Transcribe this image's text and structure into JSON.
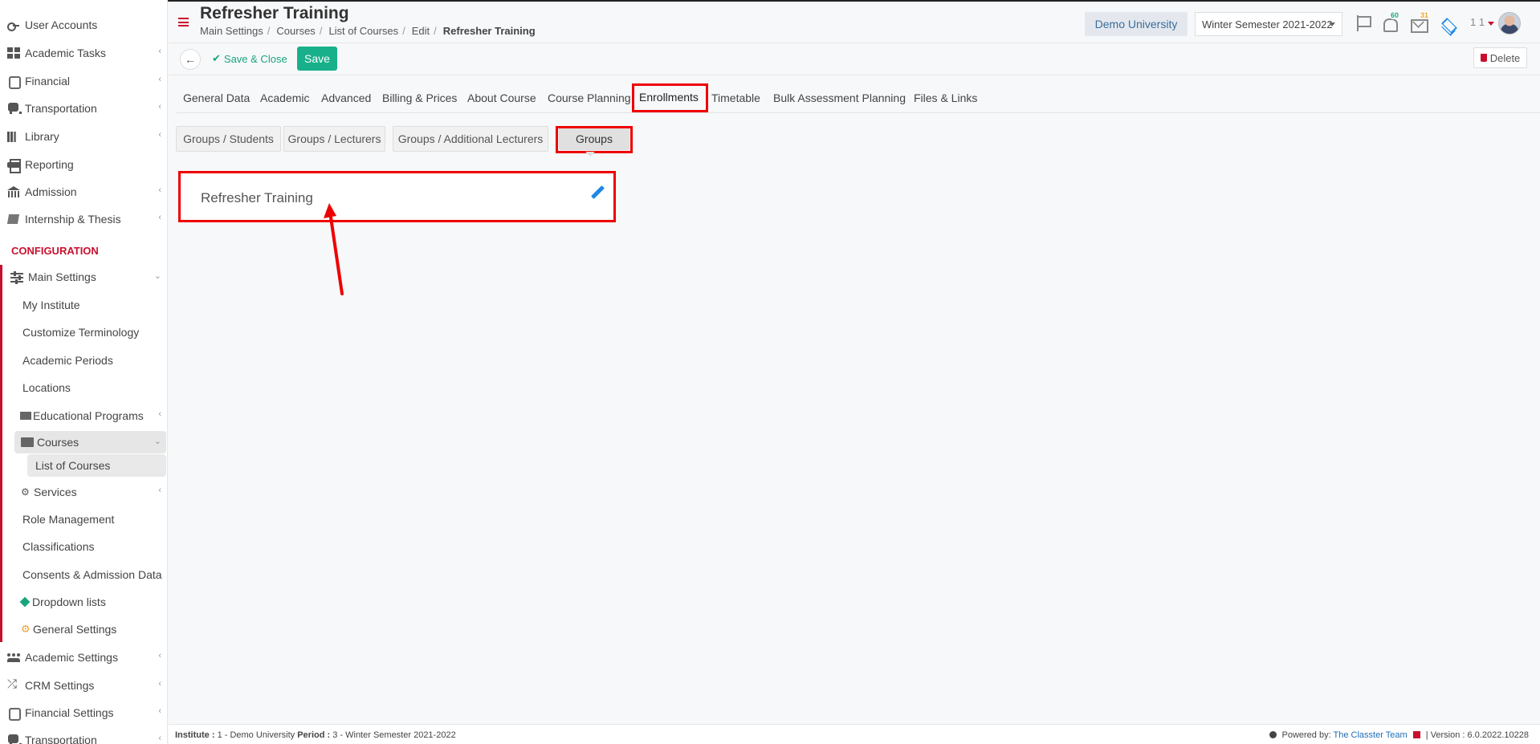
{
  "sidebar": {
    "items": [
      {
        "label": "User Accounts",
        "icon": "key-icon",
        "chevron": false
      },
      {
        "label": "Academic Tasks",
        "icon": "grid-icon",
        "chevron": true
      },
      {
        "label": "Financial",
        "icon": "coins-icon",
        "chevron": true
      },
      {
        "label": "Transportation",
        "icon": "bus-icon",
        "chevron": true
      },
      {
        "label": "Library",
        "icon": "books-icon",
        "chevron": true
      },
      {
        "label": "Reporting",
        "icon": "printer-icon",
        "chevron": false
      },
      {
        "label": "Admission",
        "icon": "bank-icon",
        "chevron": true
      },
      {
        "label": "Internship & Thesis",
        "icon": "box-icon",
        "chevron": true
      }
    ],
    "section_label": "CONFIGURATION",
    "main_settings": "Main Settings",
    "main_settings_sub": [
      "My Institute",
      "Customize Terminology",
      "Academic Periods",
      "Locations",
      "Educational Programs",
      "Courses",
      "List of Courses",
      "Services",
      "Role Management",
      "Classifications",
      "Consents & Admission Data",
      "Dropdown lists",
      "General Settings"
    ],
    "bottom_items": [
      {
        "label": "Academic Settings",
        "icon": "people-icon"
      },
      {
        "label": "CRM Settings",
        "icon": "shuffle-icon"
      },
      {
        "label": "Financial Settings",
        "icon": "coins-icon"
      },
      {
        "label": "Transportation",
        "icon": "bus-icon"
      }
    ]
  },
  "header": {
    "title": "Refresher Training",
    "breadcrumb": [
      "Main Settings",
      "Courses",
      "List of Courses",
      "Edit",
      "Refresher Training"
    ],
    "institution": "Demo University",
    "period": "Winter Semester 2021-2022",
    "notifications_count": "60",
    "messages_count": "31",
    "user_code": "1 1"
  },
  "toolbar": {
    "save_close_label": "Save & Close",
    "save_label": "Save",
    "delete_label": "Delete"
  },
  "tabs": [
    "General Data",
    "Academic",
    "Advanced",
    "Billing & Prices",
    "About Course",
    "Course Planning",
    "Enrollments",
    "Timetable",
    "Bulk Assessment Planning",
    "Files & Links"
  ],
  "active_tab": "Enrollments",
  "subtabs": [
    "Groups / Students",
    "Groups / Lecturers",
    "Groups / Additional Lecturers",
    "Groups"
  ],
  "active_subtab": "Groups",
  "group_card": {
    "title": "Refresher Training"
  },
  "footer": {
    "institute_label": "Institute :",
    "institute_value": "1 - Demo University",
    "period_label": "Period :",
    "period_value": "3 - Winter Semester 2021-2022",
    "powered_by": "Powered by:",
    "powered_link": "The Classter Team",
    "version": "| Version : 6.0.2022.10228"
  },
  "colors": {
    "accent_red": "#c8102e",
    "save_green": "#17b08a",
    "highlight_red": "#ee0000",
    "link_blue": "#1e6fb8"
  }
}
